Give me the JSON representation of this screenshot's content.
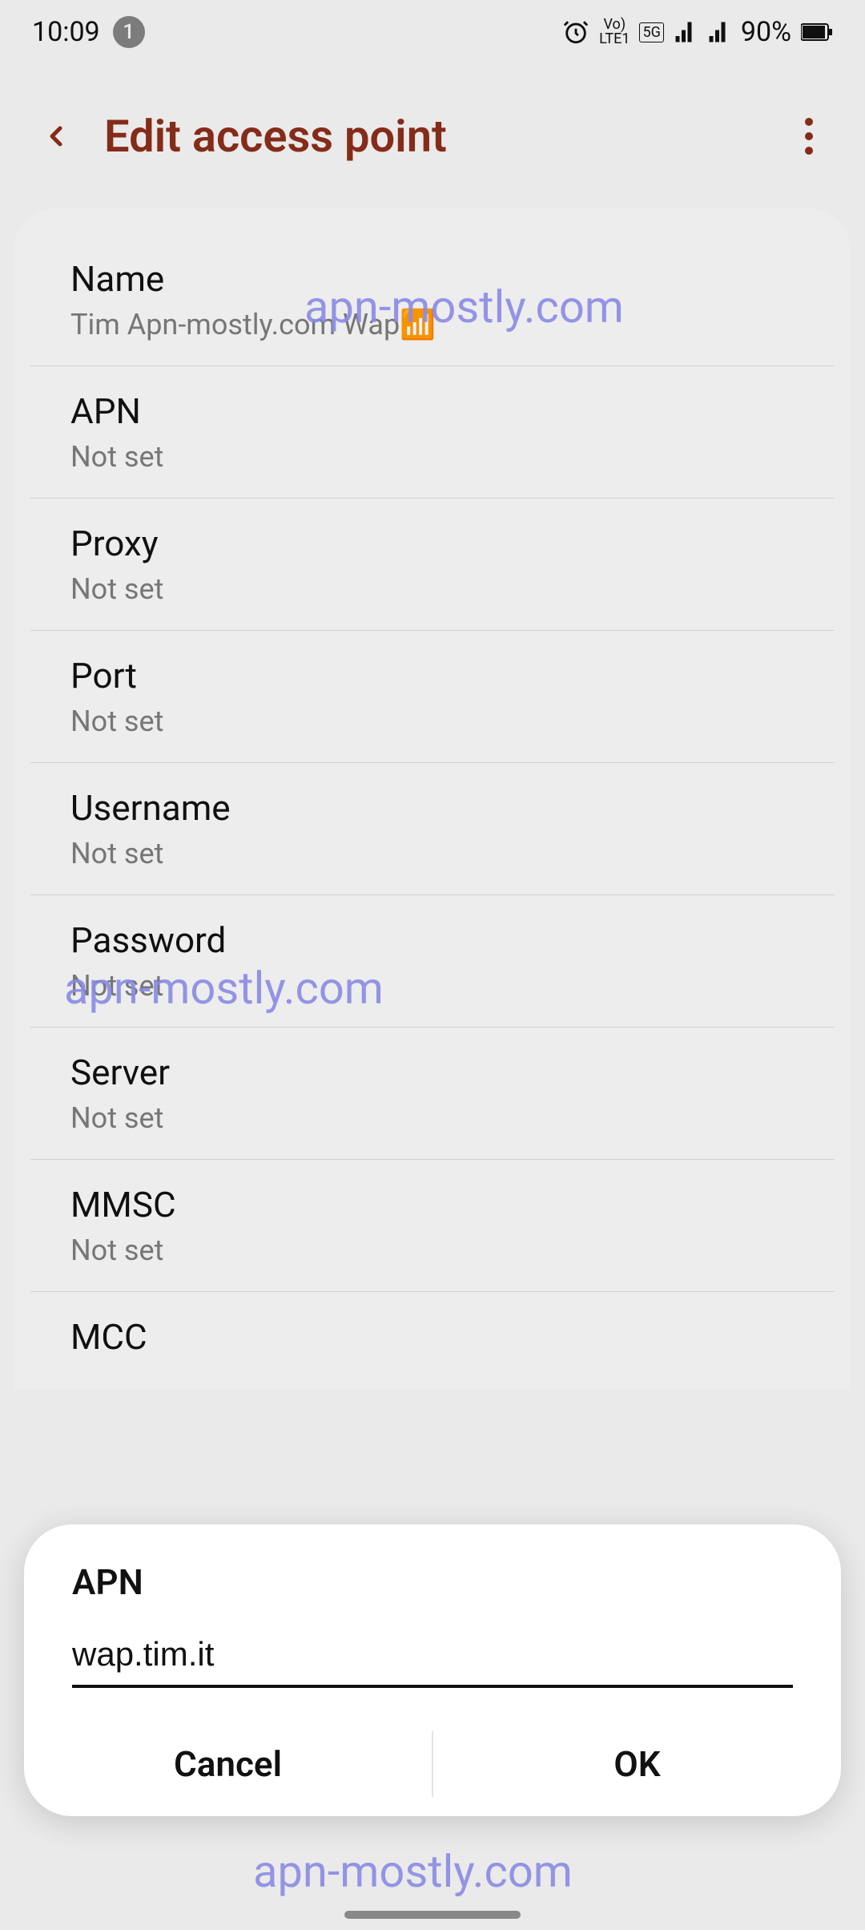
{
  "status": {
    "time": "10:09",
    "notif_count": "1",
    "battery_text": "90%"
  },
  "header": {
    "title": "Edit access point"
  },
  "settings": [
    {
      "label": "Name",
      "value": "Tim Apn-mostly.com Wap📶"
    },
    {
      "label": "APN",
      "value": "Not set"
    },
    {
      "label": "Proxy",
      "value": "Not set"
    },
    {
      "label": "Port",
      "value": "Not set"
    },
    {
      "label": "Username",
      "value": "Not set"
    },
    {
      "label": "Password",
      "value": "Not set"
    },
    {
      "label": "Server",
      "value": "Not set"
    },
    {
      "label": "MMSC",
      "value": "Not set"
    },
    {
      "label": "MCC",
      "value": ""
    }
  ],
  "dialog": {
    "title": "APN",
    "input_value": "wap.tim.it",
    "cancel": "Cancel",
    "ok": "OK"
  },
  "watermark": "apn-mostly.com"
}
